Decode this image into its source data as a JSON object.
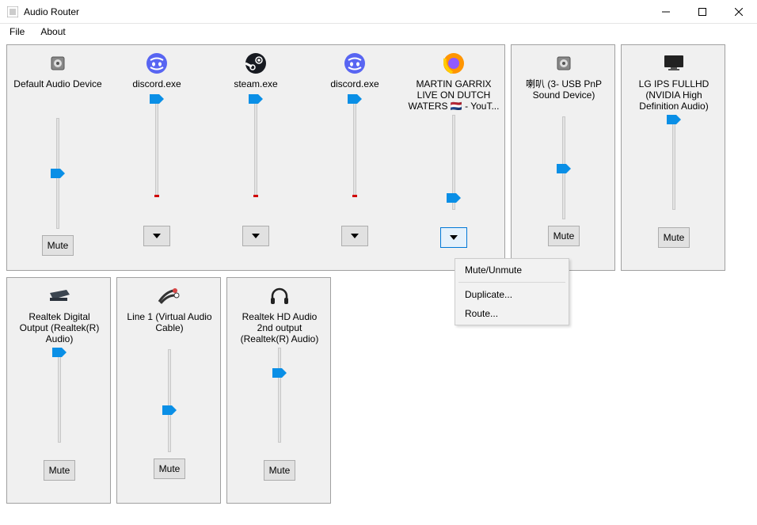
{
  "window": {
    "title": "Audio Router",
    "minimize": "—",
    "maximize": "☐",
    "close": "✕"
  },
  "menu": {
    "file": "File",
    "about": "About"
  },
  "buttons": {
    "mute": "Mute"
  },
  "context": {
    "mute_unmute": "Mute/Unmute",
    "duplicate": "Duplicate...",
    "route": "Route..."
  },
  "row1": {
    "c0": {
      "label": "Default Audio Device",
      "slider_pct": 50,
      "action": "mute"
    },
    "c1": {
      "label": "discord.exe",
      "slider_pct": 100,
      "action": "dropdown",
      "red": true
    },
    "c2": {
      "label": "steam.exe",
      "slider_pct": 100,
      "action": "dropdown",
      "red": true
    },
    "c3": {
      "label": "discord.exe",
      "slider_pct": 100,
      "action": "dropdown",
      "red": true
    },
    "c4": {
      "label1": "MARTIN GARRIX",
      "label2": "LIVE ON DUTCH",
      "label3": "WATERS 🇳🇱 - YouT...",
      "slider_pct": 8,
      "action": "dropdown",
      "selected": true
    },
    "c5": {
      "label1": "喇叭 (3- USB PnP",
      "label2": "Sound Device)",
      "slider_pct": 49,
      "action": "mute"
    },
    "c6": {
      "label1": "LG IPS FULLHD",
      "label2": "(NVIDIA High",
      "label3": "Definition Audio)",
      "slider_pct": 100,
      "action": "mute"
    }
  },
  "row2": {
    "c0": {
      "label1": "Realtek Digital",
      "label2": "Output (Realtek(R)",
      "label3": "Audio)",
      "slider_pct": 100,
      "action": "mute"
    },
    "c1": {
      "label1": "Line 1 (Virtual Audio",
      "label2": "Cable)",
      "slider_pct": 40,
      "action": "mute"
    },
    "c2": {
      "label1": "Realtek HD Audio",
      "label2": "2nd output",
      "label3": "(Realtek(R) Audio)",
      "slider_pct": 76,
      "action": "mute"
    }
  }
}
